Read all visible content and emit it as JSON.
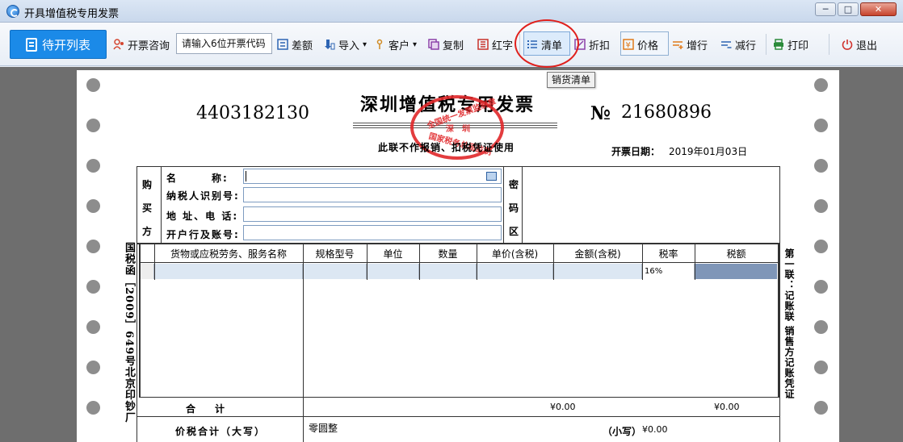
{
  "window": {
    "title": "开具增值税专用发票",
    "minimize_glyph": "─",
    "maximize_glyph": "□",
    "close_glyph": "✕"
  },
  "toolbar": {
    "pending_list": "待开列表",
    "inquiry": "开票咨询",
    "code_placeholder": "请输入6位开票代码",
    "difference": "差额",
    "import": "导入",
    "customer": "客户",
    "copy": "复制",
    "red_letter": "红字",
    "list": "清单",
    "discount": "折扣",
    "price": "价格",
    "add_row": "增行",
    "remove_row": "减行",
    "print": "打印",
    "exit": "退出",
    "dropdown_glyph": "▾",
    "list_tooltip": "销货清单"
  },
  "icons": [
    "document-icon",
    "inquiry-icon",
    "difference-icon",
    "import-icon",
    "customer-icon",
    "copy-icon",
    "red-letter-icon",
    "list-icon",
    "discount-icon",
    "price-icon",
    "add-row-icon",
    "remove-row-icon",
    "print-icon",
    "exit-icon"
  ],
  "invoice": {
    "title": "深圳增值税专用发票",
    "code": "4403182130",
    "no_mark": "№",
    "number": "21680896",
    "subtitle": "此联不作报销、扣税凭证使用",
    "date_label": "开票日期：",
    "date": "2019年01月03日",
    "stamp": {
      "top": "全国统一发票监制章",
      "middle": "深　圳",
      "bottom": "国家税务总局监制"
    },
    "left_vertical": "国税函［2009］649号北京印钞厂",
    "right_vertical": "第一联：记账联 销售方记账凭证",
    "buyer_section": [
      "购",
      "买",
      "方"
    ],
    "buyer_labels": [
      "名　　　称:",
      "纳税人识别号:",
      "地 址、电 话:",
      "开户行及账号:"
    ],
    "cipher_section": [
      "密",
      "码",
      "区"
    ],
    "columns": [
      "货物或应税劳务、服务名称",
      "规格型号",
      "单位",
      "数量",
      "单价(含税)",
      "金额(含税)",
      "税率",
      "税额"
    ],
    "row_rate": "16%",
    "sum_label": "合　　计",
    "amount_total": "¥0.00",
    "tax_total": "¥0.00",
    "total_label": "价税合计（大写）",
    "total_cn": "零圆整",
    "small_label": "（小写）",
    "small_amount": "¥0.00"
  },
  "colors": {
    "accent": "#1b8ae8",
    "stamp": "#e0272a",
    "highlight_circle": "#e0201c",
    "selected_cell": "#7f96b8"
  }
}
